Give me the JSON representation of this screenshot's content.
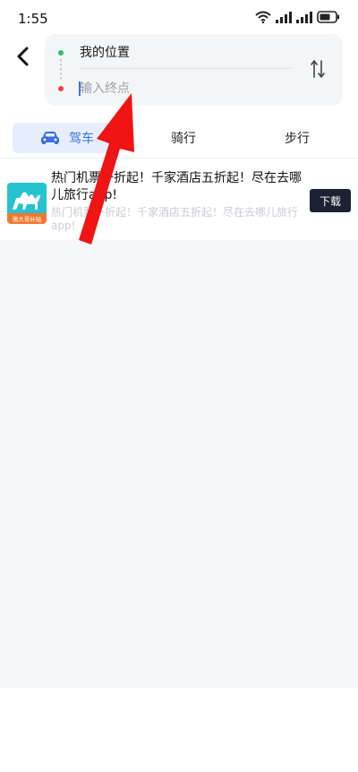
{
  "status_bar": {
    "time": "1:55",
    "icons": [
      "wifi-icon",
      "signal-icon",
      "signal-icon",
      "battery-icon"
    ]
  },
  "route": {
    "origin_label": "我的位置",
    "destination_placeholder": "输入终点"
  },
  "tabs": [
    {
      "label": "驾车",
      "icon": "car-icon",
      "active": true
    },
    {
      "label": "骑行",
      "active": false
    },
    {
      "label": "步行",
      "active": false
    }
  ],
  "ad": {
    "title": "热门机票一折起！千家酒店五折起！尽在去哪儿旅行app!",
    "subtitle": "热门机票一折起！千家酒店五折起！尽在去哪儿旅行app!",
    "icon_caption": "骆大哥补贴",
    "download_label": "下载"
  },
  "colors": {
    "accent": "#3b6fe0",
    "origin_dot": "#2bc26b",
    "destination_dot": "#f0453a",
    "annotation_arrow": "#f01414",
    "download_button": "#1c2136"
  }
}
